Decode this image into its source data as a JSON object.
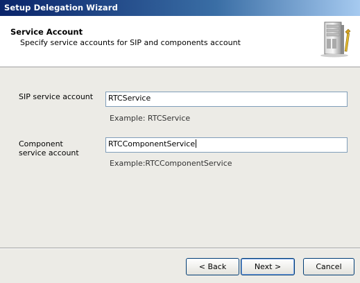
{
  "window": {
    "title": "Setup Delegation Wizard"
  },
  "header": {
    "title": "Service Account",
    "subtitle": "Specify service accounts for SIP and components account",
    "icon": "server-tools-icon"
  },
  "sip": {
    "label": "SIP service account",
    "value": "RTCService",
    "example": "Example: RTCService"
  },
  "component": {
    "label": "Component service account",
    "value": "RTCComponentService",
    "example": "Example:RTCComponentService"
  },
  "buttons": {
    "back": "< Back",
    "next": "Next >",
    "cancel": "Cancel"
  }
}
